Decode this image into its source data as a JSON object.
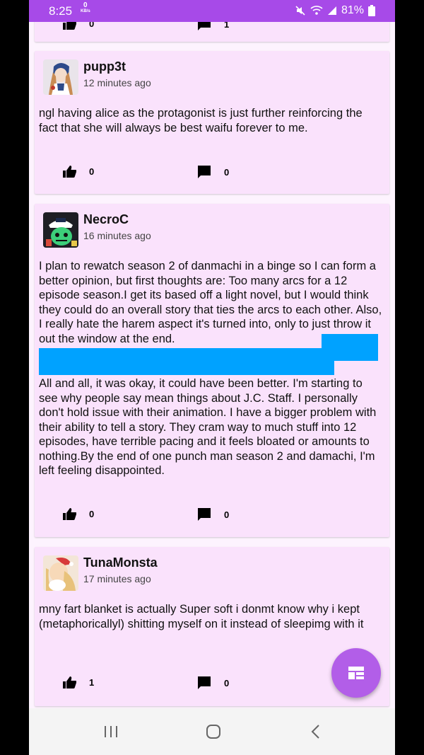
{
  "status": {
    "time": "8:25",
    "speed_value": "0",
    "speed_unit": "KB/s",
    "battery": "81%"
  },
  "posts": [
    {
      "username": "pupp3t",
      "time": "12 minutes ago",
      "body": "ngl having alice as the protagonist is just further reinforcing the fact that she will always be best waifu forever to me.",
      "likes": "0",
      "comments": "0"
    },
    {
      "username": "NecroC",
      "time": "16 minutes ago",
      "body_part1": "I plan to rewatch season 2 of danmachi in a binge so I can form a better opinion, but first thoughts are: Too many arcs for a 12 episode season.I get its based off a light novel, but I would think they could do an overall story that ties the arcs to each other. Also, I really hate the harem aspect it's turned into, only to just throw it out the window at the end.",
      "body_part2": "All and all, it was okay, it could have been better. I'm starting to see why people say mean things about J.C. Staff. I personally don't hold issue with their animation. I have a bigger problem with their ability to tell a story. They cram way to much stuff into 12 episodes, have terrible pacing and it feels bloated or amounts to nothing.By the end of one punch man season 2 and damachi, I'm left feeling disappointed.",
      "likes": "0",
      "comments": "0"
    },
    {
      "username": "TunaMonsta",
      "time": "17 minutes ago",
      "body": "mny fart blanket is actually Super soft i donmt know why i kept (metaphoricallyl) shitting myself on it instead of sleepimg with it",
      "likes": "1",
      "comments": "0"
    }
  ],
  "top_partial": {
    "likes": "0",
    "comments": "1"
  },
  "icons": {
    "like": "thumbs-up-icon",
    "comment": "comment-icon",
    "fab": "dashboard-icon",
    "nav_recents": "recents-icon",
    "nav_home": "home-icon",
    "nav_back": "back-icon"
  },
  "colors": {
    "status_bar": "#a74ae8",
    "card": "#fae2fc",
    "fab": "#b25ee8",
    "highlight": "#00a2ff"
  }
}
